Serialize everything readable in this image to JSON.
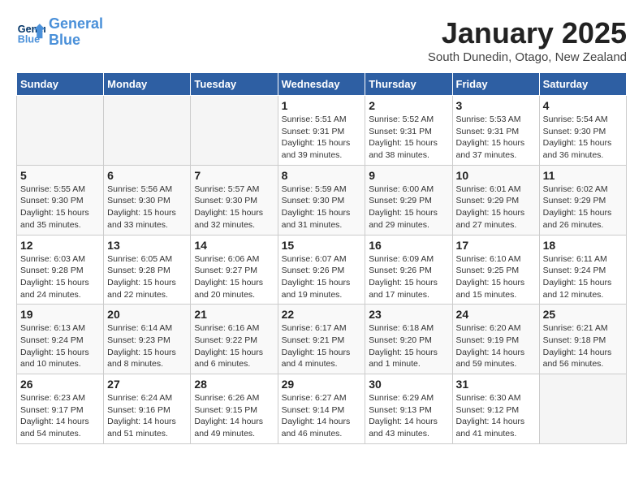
{
  "logo": {
    "text_general": "General",
    "text_blue": "Blue"
  },
  "title": "January 2025",
  "subtitle": "South Dunedin, Otago, New Zealand",
  "weekdays": [
    "Sunday",
    "Monday",
    "Tuesday",
    "Wednesday",
    "Thursday",
    "Friday",
    "Saturday"
  ],
  "weeks": [
    [
      {
        "day": "",
        "info": ""
      },
      {
        "day": "",
        "info": ""
      },
      {
        "day": "",
        "info": ""
      },
      {
        "day": "1",
        "info": "Sunrise: 5:51 AM\nSunset: 9:31 PM\nDaylight: 15 hours\nand 39 minutes."
      },
      {
        "day": "2",
        "info": "Sunrise: 5:52 AM\nSunset: 9:31 PM\nDaylight: 15 hours\nand 38 minutes."
      },
      {
        "day": "3",
        "info": "Sunrise: 5:53 AM\nSunset: 9:31 PM\nDaylight: 15 hours\nand 37 minutes."
      },
      {
        "day": "4",
        "info": "Sunrise: 5:54 AM\nSunset: 9:30 PM\nDaylight: 15 hours\nand 36 minutes."
      }
    ],
    [
      {
        "day": "5",
        "info": "Sunrise: 5:55 AM\nSunset: 9:30 PM\nDaylight: 15 hours\nand 35 minutes."
      },
      {
        "day": "6",
        "info": "Sunrise: 5:56 AM\nSunset: 9:30 PM\nDaylight: 15 hours\nand 33 minutes."
      },
      {
        "day": "7",
        "info": "Sunrise: 5:57 AM\nSunset: 9:30 PM\nDaylight: 15 hours\nand 32 minutes."
      },
      {
        "day": "8",
        "info": "Sunrise: 5:59 AM\nSunset: 9:30 PM\nDaylight: 15 hours\nand 31 minutes."
      },
      {
        "day": "9",
        "info": "Sunrise: 6:00 AM\nSunset: 9:29 PM\nDaylight: 15 hours\nand 29 minutes."
      },
      {
        "day": "10",
        "info": "Sunrise: 6:01 AM\nSunset: 9:29 PM\nDaylight: 15 hours\nand 27 minutes."
      },
      {
        "day": "11",
        "info": "Sunrise: 6:02 AM\nSunset: 9:29 PM\nDaylight: 15 hours\nand 26 minutes."
      }
    ],
    [
      {
        "day": "12",
        "info": "Sunrise: 6:03 AM\nSunset: 9:28 PM\nDaylight: 15 hours\nand 24 minutes."
      },
      {
        "day": "13",
        "info": "Sunrise: 6:05 AM\nSunset: 9:28 PM\nDaylight: 15 hours\nand 22 minutes."
      },
      {
        "day": "14",
        "info": "Sunrise: 6:06 AM\nSunset: 9:27 PM\nDaylight: 15 hours\nand 20 minutes."
      },
      {
        "day": "15",
        "info": "Sunrise: 6:07 AM\nSunset: 9:26 PM\nDaylight: 15 hours\nand 19 minutes."
      },
      {
        "day": "16",
        "info": "Sunrise: 6:09 AM\nSunset: 9:26 PM\nDaylight: 15 hours\nand 17 minutes."
      },
      {
        "day": "17",
        "info": "Sunrise: 6:10 AM\nSunset: 9:25 PM\nDaylight: 15 hours\nand 15 minutes."
      },
      {
        "day": "18",
        "info": "Sunrise: 6:11 AM\nSunset: 9:24 PM\nDaylight: 15 hours\nand 12 minutes."
      }
    ],
    [
      {
        "day": "19",
        "info": "Sunrise: 6:13 AM\nSunset: 9:24 PM\nDaylight: 15 hours\nand 10 minutes."
      },
      {
        "day": "20",
        "info": "Sunrise: 6:14 AM\nSunset: 9:23 PM\nDaylight: 15 hours\nand 8 minutes."
      },
      {
        "day": "21",
        "info": "Sunrise: 6:16 AM\nSunset: 9:22 PM\nDaylight: 15 hours\nand 6 minutes."
      },
      {
        "day": "22",
        "info": "Sunrise: 6:17 AM\nSunset: 9:21 PM\nDaylight: 15 hours\nand 4 minutes."
      },
      {
        "day": "23",
        "info": "Sunrise: 6:18 AM\nSunset: 9:20 PM\nDaylight: 15 hours\nand 1 minute."
      },
      {
        "day": "24",
        "info": "Sunrise: 6:20 AM\nSunset: 9:19 PM\nDaylight: 14 hours\nand 59 minutes."
      },
      {
        "day": "25",
        "info": "Sunrise: 6:21 AM\nSunset: 9:18 PM\nDaylight: 14 hours\nand 56 minutes."
      }
    ],
    [
      {
        "day": "26",
        "info": "Sunrise: 6:23 AM\nSunset: 9:17 PM\nDaylight: 14 hours\nand 54 minutes."
      },
      {
        "day": "27",
        "info": "Sunrise: 6:24 AM\nSunset: 9:16 PM\nDaylight: 14 hours\nand 51 minutes."
      },
      {
        "day": "28",
        "info": "Sunrise: 6:26 AM\nSunset: 9:15 PM\nDaylight: 14 hours\nand 49 minutes."
      },
      {
        "day": "29",
        "info": "Sunrise: 6:27 AM\nSunset: 9:14 PM\nDaylight: 14 hours\nand 46 minutes."
      },
      {
        "day": "30",
        "info": "Sunrise: 6:29 AM\nSunset: 9:13 PM\nDaylight: 14 hours\nand 43 minutes."
      },
      {
        "day": "31",
        "info": "Sunrise: 6:30 AM\nSunset: 9:12 PM\nDaylight: 14 hours\nand 41 minutes."
      },
      {
        "day": "",
        "info": ""
      }
    ]
  ]
}
